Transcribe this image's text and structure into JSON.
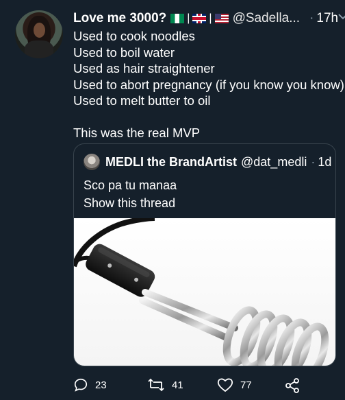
{
  "tweet": {
    "display_name": "Love me 3000?",
    "flags": [
      "nigeria-flag",
      "uk-flag",
      "us-flag"
    ],
    "handle": "@Sadella...",
    "dot": "·",
    "time": "17h",
    "lines": [
      "Used to cook noodles",
      "Used to boil water",
      "Used as hair straightener",
      "Used to abort pregnancy (if you know you know)",
      "Used to melt butter to oil",
      "",
      "This was the real MVP"
    ]
  },
  "quote": {
    "display_name": "MEDLI the BrandArtist",
    "handle": "@dat_medli",
    "dot": "·",
    "time": "1d",
    "text": "Sco pa tu manaa",
    "show_thread": "Show this thread",
    "image": "immersion-heater-coil-photo"
  },
  "actions": {
    "reply_count": "23",
    "retweet_count": "41",
    "like_count": "77",
    "share_icon": "share-icon"
  },
  "colors": {
    "background": "#15202b",
    "text": "#ffffff",
    "muted": "#8899a6",
    "border": "#38444d"
  }
}
